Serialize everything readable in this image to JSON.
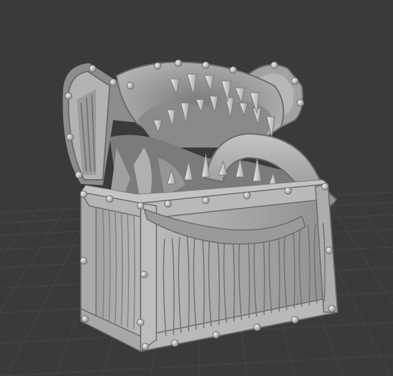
{
  "viewport": {
    "subject": "3d-model-mimic-chest",
    "background_color": "#3a3a3a",
    "grid_color": "#474747",
    "grid_highlight_color": "#4f4f4f",
    "model_base_color": "#a9a9a9",
    "model_shadow_color": "#6f6f6f",
    "model_highlight_color": "#d6d6d6"
  }
}
